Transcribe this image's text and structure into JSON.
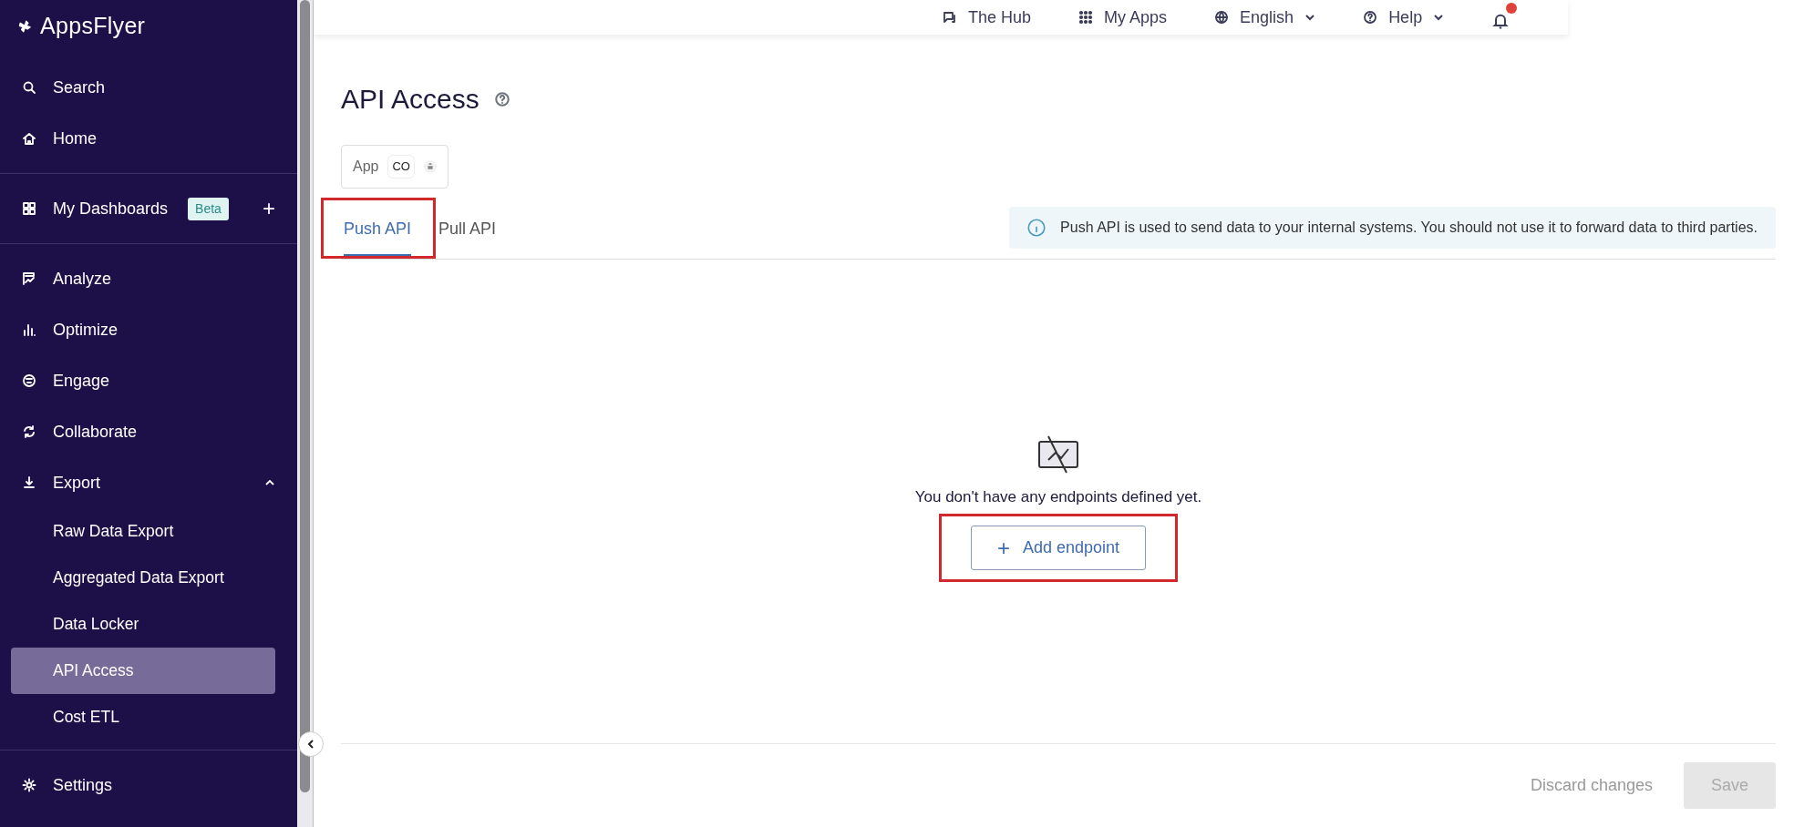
{
  "sidebar": {
    "logo": "AppsFlyer",
    "groups": [
      [
        {
          "label": "Search"
        },
        {
          "label": "Home"
        }
      ],
      [
        {
          "label": "My Dashboards",
          "badge": "Beta",
          "add": "+"
        }
      ],
      [
        {
          "label": "Analyze"
        },
        {
          "label": "Optimize"
        },
        {
          "label": "Engage"
        },
        {
          "label": "Collaborate"
        },
        {
          "label": "Export",
          "expanded": true,
          "children": [
            {
              "label": "Raw Data Export",
              "selected": false
            },
            {
              "label": "Aggregated Data Export",
              "selected": false
            },
            {
              "label": "Data Locker",
              "selected": false
            },
            {
              "label": "API Access",
              "selected": true
            },
            {
              "label": "Cost ETL",
              "selected": false
            }
          ]
        }
      ],
      [
        {
          "label": "Settings"
        }
      ]
    ]
  },
  "top_bar": {
    "items": [
      {
        "label": "The Hub",
        "dropdown": false
      },
      {
        "label": "My Apps",
        "dropdown": false
      },
      {
        "label": "English",
        "dropdown": true
      },
      {
        "label": "Help",
        "dropdown": true
      }
    ]
  },
  "page": {
    "title": "API Access",
    "app_selector": {
      "label": "App",
      "value": "CO"
    },
    "tabs": [
      {
        "label": "Push API",
        "selected": true,
        "annotated": true
      },
      {
        "label": "Pull API",
        "selected": false,
        "annotated": false
      }
    ],
    "info": "Push API is used to send data to your internal systems. You should not use it to forward data to third parties.",
    "empty_message": "You don't have any endpoints defined yet.",
    "add_button": {
      "label": "Add endpoint",
      "icon": "+",
      "annotated": true
    },
    "footer": {
      "discard": "Discard changes",
      "save": "Save",
      "save_disabled": true
    }
  }
}
